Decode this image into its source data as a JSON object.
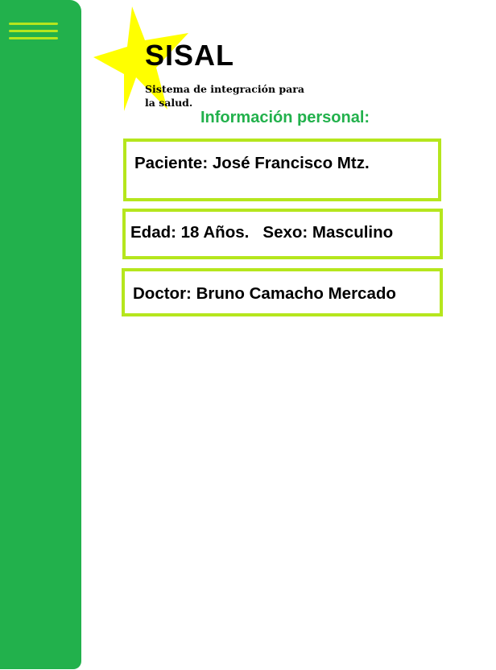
{
  "app": {
    "name": "SISAL",
    "tagline": "Sistema de integración para la salud."
  },
  "menu": {
    "icon": "hamburger-menu-icon"
  },
  "section": {
    "title": "Información personal:"
  },
  "patient": {
    "name_line": "Paciente: José Francisco Mtz.",
    "age_sex_line": "Edad: 18 Años.   Sexo: Masculino",
    "doctor_line": "Doctor: Bruno Camacho Mercado"
  },
  "colors": {
    "sidebar": "#22b14c",
    "accent_lime": "#b5e61d",
    "star": "#ffff00",
    "section_title": "#22b14c"
  }
}
